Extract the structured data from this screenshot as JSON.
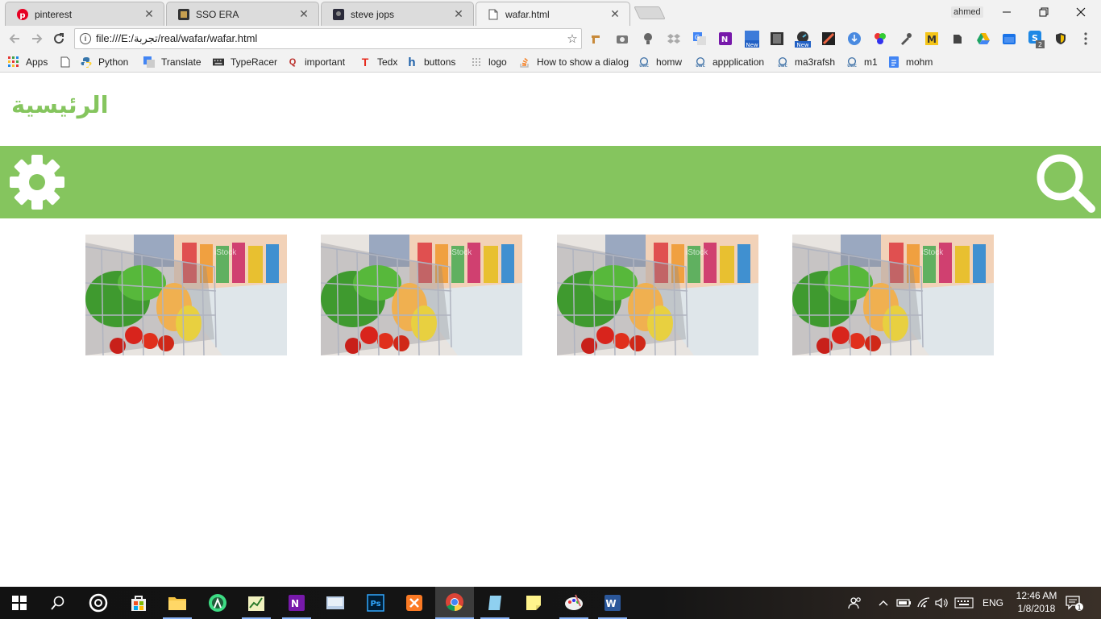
{
  "browser": {
    "tabs": [
      {
        "title": "pinterest",
        "icon": "pinterest-icon",
        "active": false
      },
      {
        "title": "SSO ERA",
        "icon": "sso-era-icon",
        "active": false
      },
      {
        "title": "steve jops",
        "icon": "steve-jops-icon",
        "active": false
      },
      {
        "title": "wafar.html",
        "icon": "file-icon",
        "active": true
      }
    ],
    "profile_name": "ahmed",
    "address": {
      "url": "file:///E:/تجربة/real/wafar/wafar.html"
    },
    "extension_badges": {
      "new_1": "New",
      "new_2": "New",
      "count": "2",
      "m_letter": "M"
    },
    "bookmarks": [
      {
        "label": "Apps",
        "icon": "apps-grid-icon"
      },
      {
        "label": "",
        "icon": "page-icon"
      },
      {
        "label": "Python",
        "icon": "python-icon"
      },
      {
        "label": "Translate",
        "icon": "google-translate-icon"
      },
      {
        "label": "TypeRacer",
        "icon": "typeracer-icon"
      },
      {
        "label": "important",
        "icon": "quora-icon"
      },
      {
        "label": "Tedx",
        "icon": "tedx-icon"
      },
      {
        "label": "buttons",
        "icon": "buttons-icon"
      },
      {
        "label": "logo",
        "icon": "logo-dots-icon"
      },
      {
        "label": "How to show a dialog",
        "icon": "stackoverflow-icon"
      },
      {
        "label": "homw",
        "icon": "uwc-icon"
      },
      {
        "label": "appplication",
        "icon": "uwc-icon"
      },
      {
        "label": "ma3rafsh",
        "icon": "uwc-icon"
      },
      {
        "label": "m1",
        "icon": "uwc-icon"
      },
      {
        "label": "mohm",
        "icon": "docs-icon"
      }
    ]
  },
  "page": {
    "title": "الرئيسية",
    "accent_color": "#85c55e",
    "products": [
      {
        "image": "shopping-cart-groceries"
      },
      {
        "image": "shopping-cart-groceries"
      },
      {
        "image": "shopping-cart-groceries"
      },
      {
        "image": "shopping-cart-groceries"
      }
    ],
    "watermark": "iStock"
  },
  "taskbar": {
    "apps": [
      "windows-start-icon",
      "search-icon",
      "cortana-icon",
      "store-icon",
      "file-explorer-icon",
      "android-studio-icon",
      "app-icon",
      "onenote-icon",
      "app-icon",
      "photoshop-icon",
      "xampp-icon",
      "chrome-icon",
      "app-icon",
      "sticky-notes-icon",
      "paint-icon",
      "word-icon"
    ],
    "language": "ENG",
    "time": "12:46 AM",
    "date": "1/8/2018",
    "notification_count": "1"
  }
}
